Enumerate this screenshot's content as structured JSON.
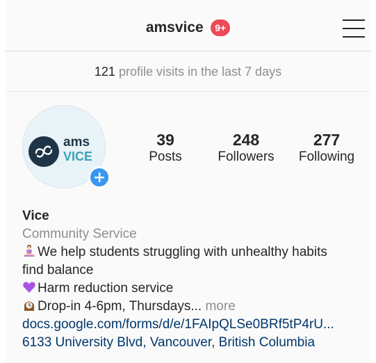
{
  "header": {
    "username": "amsvice",
    "notification_badge": "9+",
    "menu_icon": "hamburger-menu-icon"
  },
  "insights": {
    "visits_count": "121",
    "visits_text": "profile visits in the last 7 days"
  },
  "profile": {
    "avatar_logo_top": "ams",
    "avatar_logo_bottom": "VICE",
    "add_story_icon": "plus-icon",
    "stats": {
      "posts": {
        "value": "39",
        "label": "Posts"
      },
      "followers": {
        "value": "248",
        "label": "Followers"
      },
      "following": {
        "value": "277",
        "label": "Following"
      }
    }
  },
  "bio": {
    "name": "Vice",
    "category": "Community Service",
    "line1": "We help students struggling with unhealthy habits",
    "line2": "find balance",
    "line3": "Harm reduction service",
    "line4": "Drop-in 4-6pm, Thursdays...",
    "more": "more",
    "link": "docs.google.com/forms/d/e/1FAIpQLSe0BRf5tP4rU...",
    "address": "6133 University Blvd, Vancouver, British Columbia"
  },
  "colors": {
    "badge": "#ed4956",
    "add_button": "#3897f0",
    "link": "#00376b",
    "secondary_text": "#8e8e8e"
  }
}
